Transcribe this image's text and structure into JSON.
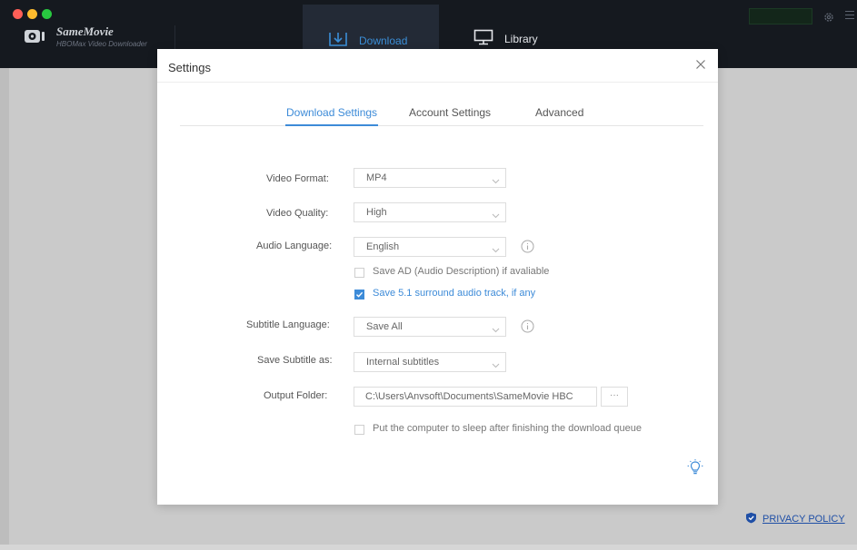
{
  "app": {
    "name": "SameMovie",
    "subtitle": "HBOMax Video Downloader"
  },
  "nav": {
    "download_label": "Download",
    "library_label": "Library"
  },
  "dialog": {
    "title": "Settings",
    "tabs": [
      {
        "label": "Download Settings",
        "active": true
      },
      {
        "label": "Account Settings",
        "active": false
      },
      {
        "label": "Advanced",
        "active": false
      }
    ],
    "fields": {
      "video_format": {
        "label": "Video Format:",
        "value": "MP4"
      },
      "video_quality": {
        "label": "Video Quality:",
        "value": "High"
      },
      "audio_language": {
        "label": "Audio Language:",
        "value": "English"
      },
      "subtitle_language": {
        "label": "Subtitle Language:",
        "value": "Save All"
      },
      "save_subtitle_as": {
        "label": "Save Subtitle as:",
        "value": "Internal subtitles"
      },
      "output_folder": {
        "label": "Output Folder:",
        "value": "C:\\Users\\Anvsoft\\Documents\\SameMovie HBC",
        "browse_label": "···"
      }
    },
    "checkboxes": {
      "save_ad": {
        "label": "Save AD (Audio Description) if avaliable",
        "checked": false
      },
      "save_51": {
        "label": "Save 5.1 surround audio track, if any",
        "checked": true
      },
      "sleep": {
        "label": "Put the computer to sleep after finishing the download queue",
        "checked": false
      }
    }
  },
  "footer": {
    "privacy_label": "PRIVACY POLICY"
  },
  "colors": {
    "accent": "#3d8bd8",
    "titlebar": "#15191f",
    "traffic_red": "#ff5f57",
    "traffic_yellow": "#febc2e",
    "traffic_green": "#28c840"
  },
  "icons": {
    "logo": "samemovie-logo-icon",
    "download": "download-icon",
    "library": "monitor-icon",
    "settings": "gear-icon",
    "menu": "menu-icon",
    "close": "close-icon",
    "info": "info-icon",
    "tip": "lightbulb-icon",
    "privacy": "shield-icon"
  }
}
